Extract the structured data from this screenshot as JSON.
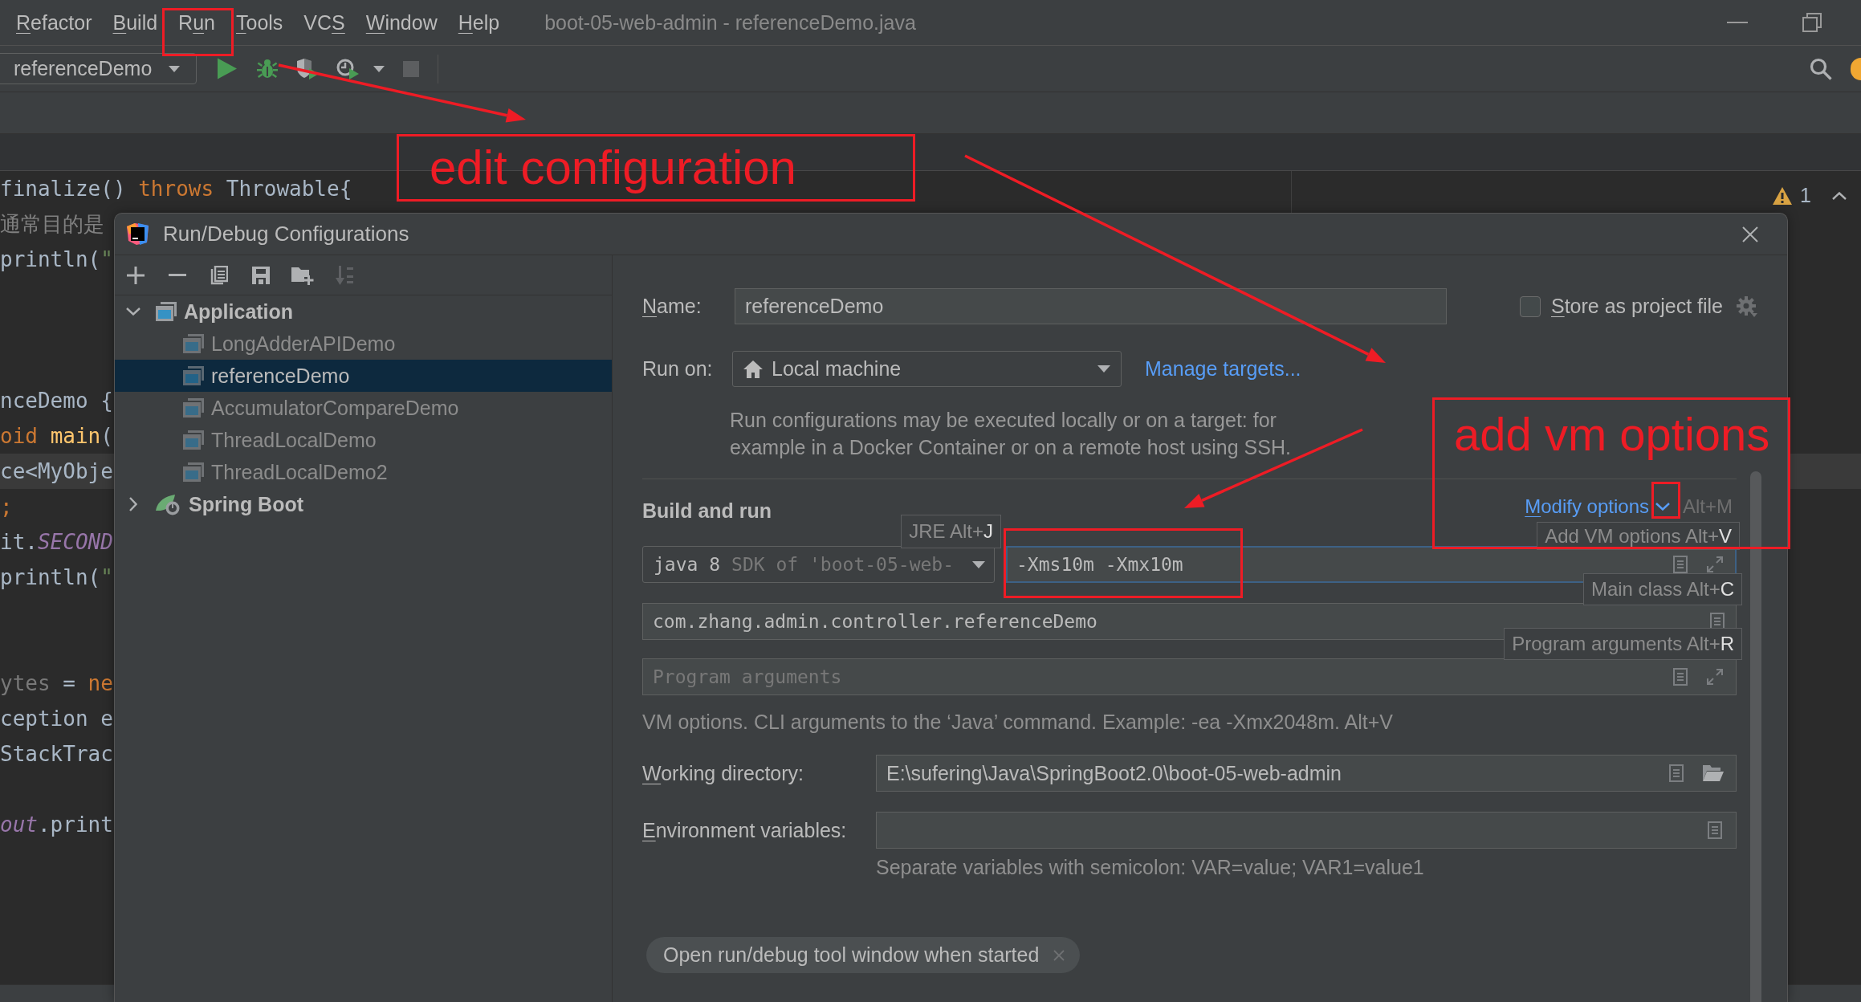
{
  "menu_bar": {
    "items": [
      {
        "underlined": "R",
        "after": "efactor"
      },
      {
        "underlined": "B",
        "after": "uild"
      },
      {
        "before": "R",
        "underlined": "u",
        "after": "n"
      },
      {
        "underlined": "T",
        "after": "ools"
      },
      {
        "before": "VC",
        "underlined": "S"
      },
      {
        "underlined": "W",
        "after": "indow"
      },
      {
        "underlined": "H",
        "after": "elp"
      }
    ],
    "title": "boot-05-web-admin - referenceDemo.java"
  },
  "toolbar": {
    "configuration": "referenceDemo",
    "buttons": [
      {
        "kind": "run",
        "disabled": false
      },
      {
        "kind": "debug",
        "disabled": false
      },
      {
        "kind": "coverage",
        "disabled": false
      },
      {
        "kind": "profile",
        "disabled": false
      },
      {
        "kind": "more",
        "disabled": false
      },
      {
        "kind": "stop",
        "disabled": true
      }
    ]
  },
  "editor": {
    "lines": [
      {
        "current": false,
        "tokens": [
          {
            "text": "finalize() ",
            "kind": "plain"
          },
          {
            "text": "throws",
            "kind": "keyword"
          },
          {
            "text": " Throwable{",
            "kind": "plain"
          }
        ]
      },
      {
        "current": false,
        "tokens": [
          {
            "text": "通常目的是",
            "kind": "comment"
          }
        ]
      },
      {
        "current": false,
        "tokens": [
          {
            "text": "println(",
            "kind": "plain"
          },
          {
            "text": "\"",
            "kind": "string"
          }
        ]
      },
      {
        "current": false
      },
      {
        "current": false
      },
      {
        "current": false
      },
      {
        "current": false,
        "tokens": [
          {
            "text": "nceDemo {",
            "kind": "plain"
          }
        ]
      },
      {
        "current": false,
        "tokens": [
          {
            "text": "oid ",
            "kind": "keyword"
          },
          {
            "text": "main",
            "kind": "method"
          },
          {
            "text": "(",
            "kind": "plain"
          }
        ]
      },
      {
        "current": true,
        "tokens": [
          {
            "text": "ce<MyObje",
            "kind": "plain"
          }
        ]
      },
      {
        "current": false,
        "tokens": [
          {
            "text": ";",
            "kind": "keyword"
          }
        ]
      },
      {
        "current": false,
        "tokens": [
          {
            "text": "it.",
            "kind": "plain"
          },
          {
            "text": "SECOND",
            "kind": "constant"
          }
        ]
      },
      {
        "current": false,
        "tokens": [
          {
            "text": "println(",
            "kind": "plain"
          },
          {
            "text": "\"",
            "kind": "string"
          }
        ]
      },
      {
        "current": false
      },
      {
        "current": false
      },
      {
        "current": false,
        "tokens": [
          {
            "text": "ytes",
            "kind": "unused"
          },
          {
            "text": " = ",
            "kind": "plain"
          },
          {
            "text": "ne",
            "kind": "keyword"
          }
        ]
      },
      {
        "current": false,
        "tokens": [
          {
            "text": "ception e",
            "kind": "plain"
          }
        ]
      },
      {
        "current": false,
        "tokens": [
          {
            "text": "StackTrac",
            "kind": "plain"
          }
        ]
      },
      {
        "current": false
      },
      {
        "current": false,
        "tokens": [
          {
            "text": "out",
            "kind": "constant"
          },
          {
            "text": ".print",
            "kind": "plain"
          }
        ]
      }
    ],
    "warnings": "1"
  },
  "dialog": {
    "title": "Run/Debug Configurations",
    "toolbar": [
      {
        "kind": "add",
        "disabled": false
      },
      {
        "kind": "remove",
        "disabled": false
      },
      {
        "kind": "copy",
        "disabled": false
      },
      {
        "kind": "save",
        "disabled": false
      },
      {
        "kind": "new-folder",
        "disabled": false
      },
      {
        "kind": "sort",
        "disabled": true
      }
    ],
    "tree": [
      {
        "label": "Application",
        "kind": "application-group",
        "expanded": true,
        "selected": false,
        "children": [
          {
            "label": "LongAdderAPIDemo",
            "kind": "application",
            "selected": false
          },
          {
            "label": "referenceDemo",
            "kind": "application",
            "selected": true
          },
          {
            "label": "AccumulatorCompareDemo",
            "kind": "application",
            "selected": false
          },
          {
            "label": "ThreadLocalDemo",
            "kind": "application",
            "selected": false
          },
          {
            "label": "ThreadLocalDemo2",
            "kind": "application",
            "selected": false
          }
        ]
      },
      {
        "label": "Spring Boot",
        "kind": "spring-boot-group",
        "expanded": false,
        "selected": false
      }
    ],
    "name": {
      "label": {
        "underlined": "N",
        "after": "ame:"
      },
      "value": "referenceDemo"
    },
    "store_as_project_file": {
      "label": {
        "underlined": "S",
        "after": "tore as project file"
      },
      "checked": false
    },
    "run_on": {
      "label": "Run on:",
      "value": "Local machine",
      "link": "Manage targets...",
      "description": "Run configurations may be executed locally or on a target: for\nexample in a Docker Container or on a remote host using SSH."
    },
    "build_and_run": {
      "title": "Build and run",
      "modify_options": {
        "label": {
          "underlined": "M",
          "after": "odify options"
        },
        "shortcut": "Alt+M"
      },
      "jre": {
        "version": "java 8",
        "detail": "SDK of 'boot-05-web-"
      },
      "vm_options": {
        "value": "-Xms10m -Xmx10m",
        "focused": true
      },
      "main_class": {
        "value": "com.zhang.admin.controller.referenceDemo"
      },
      "program_arguments": {
        "placeholder": "Program arguments"
      },
      "hint": "VM options. CLI arguments to the ‘Java’ command. Example: -ea -Xmx2048m. Alt+V"
    },
    "shortcut_hints": [
      {
        "text": "JRE Alt+",
        "key": "J"
      },
      {
        "text": "Add VM options Alt+",
        "key": "V"
      },
      {
        "text": "Main class Alt+",
        "key": "C"
      },
      {
        "text": "Program arguments Alt+",
        "key": "R"
      }
    ],
    "working_directory": {
      "label": {
        "underlined": "W",
        "after": "orking directory:"
      },
      "value": "E:\\sufering\\Java\\SpringBoot2.0\\boot-05-web-admin"
    },
    "environment_variables": {
      "label": {
        "underlined": "E",
        "after": "nvironment variables:"
      },
      "hint": "Separate variables with semicolon: VAR=value; VAR1=value1"
    },
    "options": [
      {
        "label": "Open run/debug tool window when started"
      }
    ]
  },
  "annotations": [
    "edit configuration",
    "add vm options"
  ]
}
